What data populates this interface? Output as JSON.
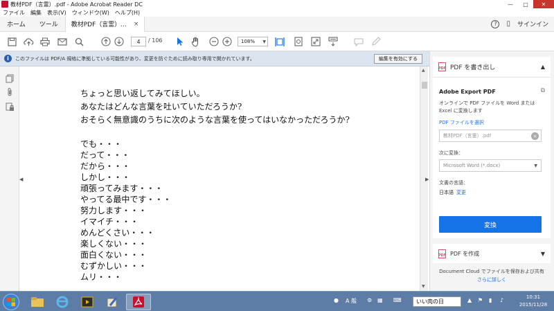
{
  "window": {
    "title": "教材PDF（言霊）.pdf - Adobe Acrobat Reader DC",
    "minimize": "—",
    "maximize": "□",
    "close": "✕"
  },
  "menu": [
    "ファイル",
    "編集",
    "表示(V)",
    "ウィンドウ(W)",
    "ヘルプ(H)"
  ],
  "tabs": {
    "home": "ホーム",
    "tools": "ツール",
    "document": "教材PDF（言霊）...",
    "document_close": "×",
    "help": "?",
    "signin": "サインイン"
  },
  "toolbar": {
    "page_current": "4",
    "page_total": "/ 106",
    "zoom": "108%"
  },
  "banner": {
    "message": "このファイルは PDF/A 規格に準拠している可能性があり、変更を防ぐために読み取り専用で開かれています。",
    "button": "編集を有効にする"
  },
  "document": {
    "lines": [
      "ちょっと思い返してみてほしい。",
      "あなたはどんな言葉を吐いていただろうか?",
      "おそらく無意識のうちに次のような言葉を使ってはいなかっただろうか?",
      "",
      "でも・・・",
      "だって・・・",
      "だから・・・",
      "しかし・・・",
      "頑張ってみます・・・",
      "やってる最中です・・・",
      "努力します・・・",
      "イマイチ・・・",
      "めんどくさい・・・",
      "楽しくない・・・",
      "面白くない・・・",
      "むずかしい・・・",
      "ムリ・・・"
    ]
  },
  "right_panel": {
    "export_header": "PDF を書き出し",
    "export_title": "Adobe Export PDF",
    "export_desc": "オンラインで PDF ファイルを Word または Excel に変換します",
    "select_file": "PDF ファイルを選択",
    "file_name": "教材PDF（言霊）.pdf",
    "convert_to_label": "次に変換：",
    "convert_to_value": "Microsoft Word (*.docx)",
    "doc_lang_label": "文書の言語：",
    "doc_lang_value": "日本語",
    "doc_lang_change": "変更",
    "convert_button": "変換",
    "create_header": "PDF を作成",
    "footer_text": "Document Cloud でファイルを保存および共有",
    "footer_link": "さらに詳しく"
  },
  "taskbar": {
    "ime_mode": "A 般",
    "ime_text": "いい肉の日",
    "time": "10:31",
    "date": "2015/11/28"
  }
}
